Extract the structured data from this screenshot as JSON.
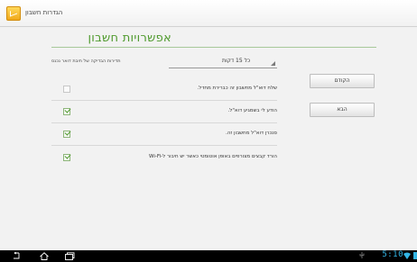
{
  "app": {
    "title": "הגדרות חשבון"
  },
  "page": {
    "heading": "אפשרויות חשבון",
    "accent_color": "#4f9a2d"
  },
  "check_interval": {
    "label": "תדירות הבדיקה של תיבת דואר נכנס",
    "value": "כל 15 דקות"
  },
  "options": [
    {
      "label": "שלח דוא\"ל מחשבון זה כברירת מחדל.",
      "checked": false
    },
    {
      "label": "הודע לי בשמגיע דוא\"ל.",
      "checked": true
    },
    {
      "label": "סנכרן דוא\"ל מחשבון זה.",
      "checked": true
    },
    {
      "label": "הורד קבצים מצורפים באופן אוטומטי כאשר יש חיבור ל-Wi-Fi",
      "checked": true
    }
  ],
  "buttons": {
    "previous": "הקודם",
    "next": "הבא"
  },
  "status_bar": {
    "time": "5:10",
    "accent_color": "#33b5e5"
  },
  "nav_icons": [
    "back-icon",
    "home-icon",
    "recent-apps-icon"
  ]
}
